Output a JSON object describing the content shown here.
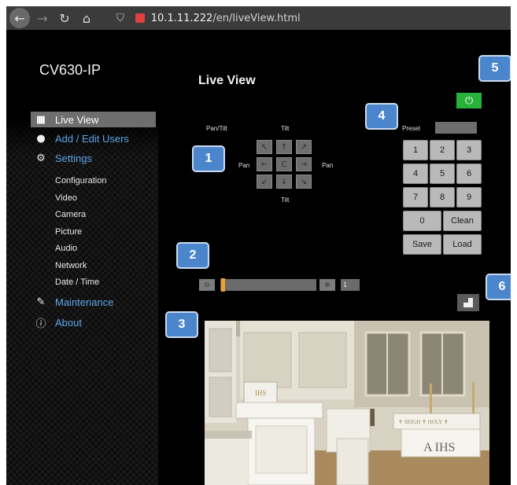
{
  "browser": {
    "back_icon": "arrow-left-icon",
    "forward_icon": "arrow-right-icon",
    "reload_icon": "reload-icon",
    "home_icon": "home-icon",
    "url_prefix": "10.1.11.222",
    "url_path": "/en/liveView.html"
  },
  "app": {
    "title": "CV630-IP",
    "page_title": "Live View"
  },
  "sidebar": {
    "items": [
      {
        "label": "Live View",
        "icon": "camera-icon",
        "active": true
      },
      {
        "label": "Add / Edit Users",
        "icon": "user-icon"
      },
      {
        "label": "Settings",
        "icon": "gear-icon"
      }
    ],
    "settings_items": [
      "Configuration",
      "Video",
      "Camera",
      "Picture",
      "Audio",
      "Network",
      "Date / Time"
    ],
    "bottom_items": [
      {
        "label": "Maintenance",
        "icon": "wrench-icon"
      },
      {
        "label": "About",
        "icon": "info-icon"
      }
    ]
  },
  "ptz": {
    "pan_tilt_label": "Pan/Tilt",
    "tilt_top_label": "Tilt",
    "tilt_bottom_label": "Tilt",
    "pan_left_label": "Pan",
    "pan_right_label": "Pan",
    "buttons": [
      "↖",
      "↑",
      "↗",
      "←",
      "C",
      "→",
      "↙",
      "↓",
      "↘"
    ]
  },
  "preset": {
    "label": "Preset",
    "value": "",
    "keys": [
      "1",
      "2",
      "3",
      "4",
      "5",
      "6",
      "7",
      "8",
      "9"
    ],
    "zero": "0",
    "clean": "Clean",
    "save": "Save",
    "load": "Load"
  },
  "zoom": {
    "out_icon": "zoom-out-icon",
    "in_icon": "zoom-in-icon",
    "value": "1",
    "level": 0.0
  },
  "power": {
    "icon": "power-icon",
    "color": "#28b23c"
  },
  "fullscreen": {
    "icon": "fullscreen-icon"
  },
  "badges": [
    "1",
    "2",
    "3",
    "4",
    "5",
    "6"
  ],
  "colors": {
    "accent": "#4b86cc",
    "link": "#5ea6e8",
    "zoom_handle": "#f0a030"
  }
}
